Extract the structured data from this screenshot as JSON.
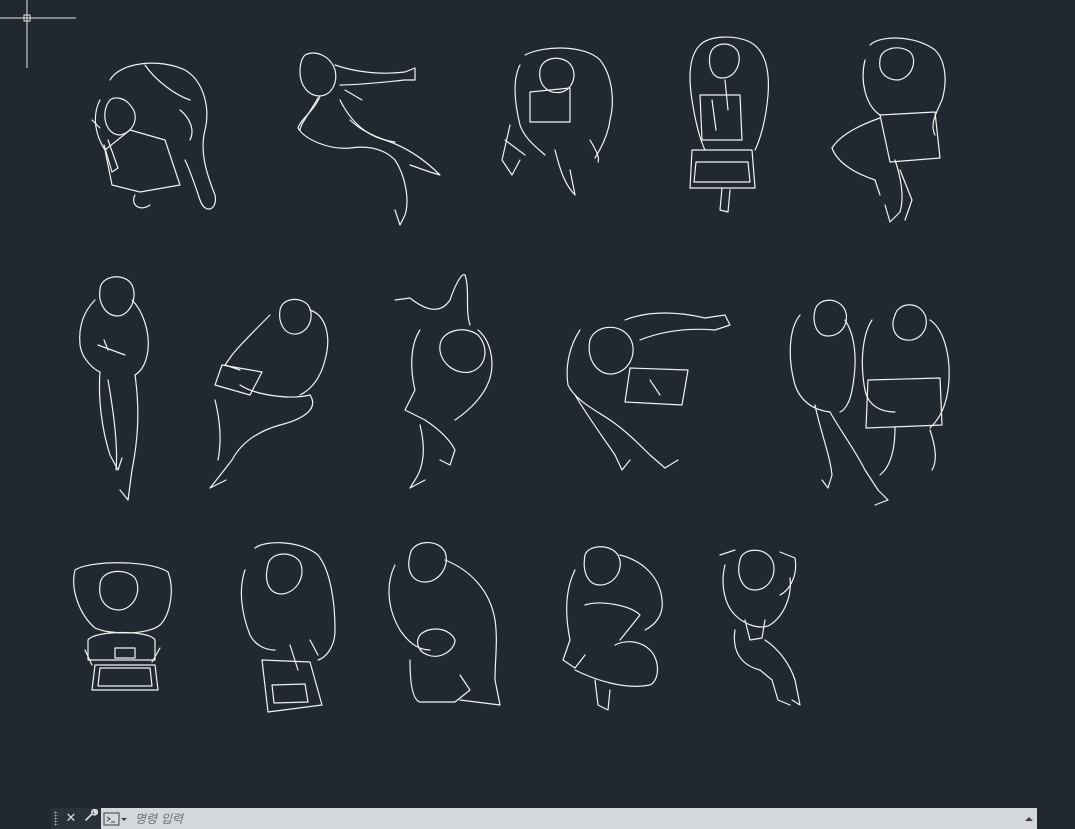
{
  "app": {
    "background_color": "#212830",
    "line_color": "#f2f2f2"
  },
  "drawing": {
    "blocks": [
      {
        "name": "person-kneeling-box"
      },
      {
        "name": "person-sitting-cross-legged"
      },
      {
        "name": "person-sitting-reading-paper"
      },
      {
        "name": "person-standing-laptop"
      },
      {
        "name": "person-sitting-holding-folder"
      },
      {
        "name": "person-standing-writing"
      },
      {
        "name": "person-sitting-with-tablet"
      },
      {
        "name": "person-leaning-waving"
      },
      {
        "name": "person-reclining-arm-raised"
      },
      {
        "name": "two-people-sitting"
      },
      {
        "name": "person-at-desk-laptop"
      },
      {
        "name": "person-sitting-with-laptop"
      },
      {
        "name": "person-kneeling"
      },
      {
        "name": "person-sitting-cross-legged-2"
      },
      {
        "name": "person-standing-hands-behind-head"
      }
    ]
  },
  "command_line": {
    "close_icon": "close-icon",
    "settings_icon": "wrench-icon",
    "prompt_icon": "command-prompt-icon",
    "placeholder": "명령 입력",
    "history_icon": "triangle-up-icon"
  }
}
